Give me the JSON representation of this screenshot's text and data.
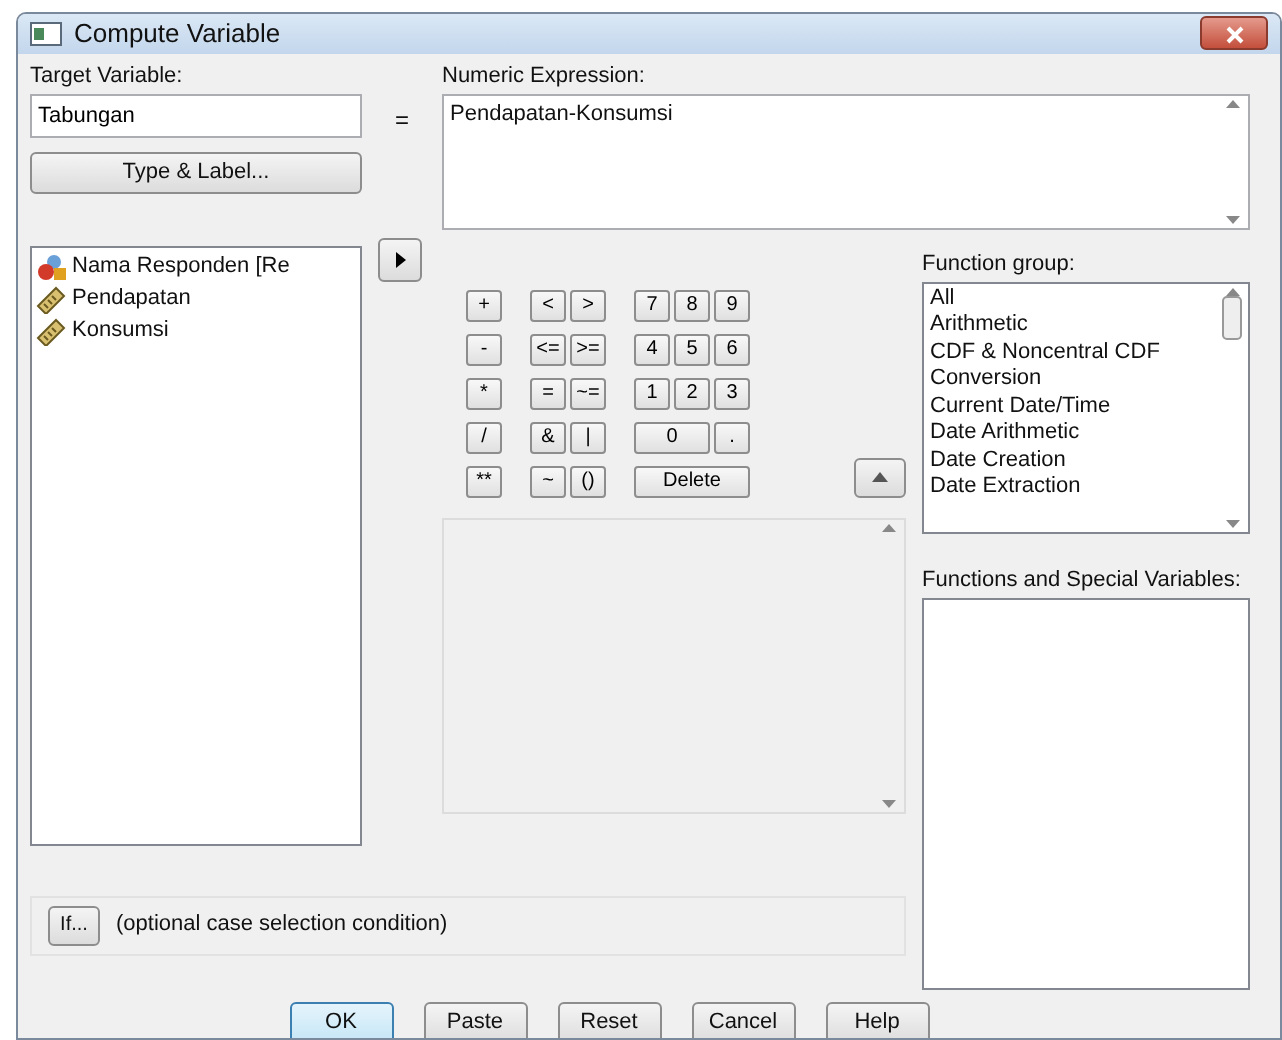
{
  "window": {
    "title": "Compute Variable"
  },
  "target_variable": {
    "label": "Target Variable:",
    "value": "Tabungan"
  },
  "equals": "=",
  "type_label_button": "Type & Label...",
  "numeric_expression": {
    "label": "Numeric Expression:",
    "value": "Pendapatan-Konsumsi"
  },
  "variables": [
    {
      "name": "Nama Responden [Re",
      "kind": "nominal"
    },
    {
      "name": "Pendapatan",
      "kind": "scale"
    },
    {
      "name": "Konsumsi",
      "kind": "scale"
    }
  ],
  "keypad": [
    [
      [
        {
          "label": "+",
          "kind": "key"
        }
      ],
      [
        {
          "label": "<",
          "kind": "key"
        },
        {
          "label": ">",
          "kind": "key"
        }
      ],
      [
        {
          "label": "7",
          "kind": "key"
        },
        {
          "label": "8",
          "kind": "key"
        },
        {
          "label": "9",
          "kind": "key"
        }
      ]
    ],
    [
      [
        {
          "label": "-",
          "kind": "key"
        }
      ],
      [
        {
          "label": "<=",
          "kind": "key"
        },
        {
          "label": ">=",
          "kind": "key"
        }
      ],
      [
        {
          "label": "4",
          "kind": "key"
        },
        {
          "label": "5",
          "kind": "key"
        },
        {
          "label": "6",
          "kind": "key"
        }
      ]
    ],
    [
      [
        {
          "label": "*",
          "kind": "key"
        }
      ],
      [
        {
          "label": "=",
          "kind": "key"
        },
        {
          "label": "~=",
          "kind": "key"
        }
      ],
      [
        {
          "label": "1",
          "kind": "key"
        },
        {
          "label": "2",
          "kind": "key"
        },
        {
          "label": "3",
          "kind": "key"
        }
      ]
    ],
    [
      [
        {
          "label": "/",
          "kind": "key"
        }
      ],
      [
        {
          "label": "&",
          "kind": "key"
        },
        {
          "label": "|",
          "kind": "key"
        }
      ],
      [
        {
          "label": "0",
          "kind": "wide"
        },
        {
          "label": ".",
          "kind": "key"
        }
      ]
    ],
    [
      [
        {
          "label": "**",
          "kind": "key"
        }
      ],
      [
        {
          "label": "~",
          "kind": "key"
        },
        {
          "label": "()",
          "kind": "key"
        }
      ],
      [
        {
          "label": "Delete",
          "kind": "delete"
        }
      ]
    ]
  ],
  "function_group": {
    "label": "Function group:",
    "items": [
      "All",
      "Arithmetic",
      "CDF & Noncentral CDF",
      "Conversion",
      "Current Date/Time",
      "Date Arithmetic",
      "Date Creation",
      "Date Extraction"
    ]
  },
  "functions_label": "Functions and Special Variables:",
  "if_button": "If...",
  "if_caption": "(optional case selection condition)",
  "buttons": [
    {
      "label": "OK",
      "selected": true
    },
    {
      "label": "Paste",
      "selected": false
    },
    {
      "label": "Reset",
      "selected": false
    },
    {
      "label": "Cancel",
      "selected": false
    },
    {
      "label": "Help",
      "selected": false
    }
  ]
}
